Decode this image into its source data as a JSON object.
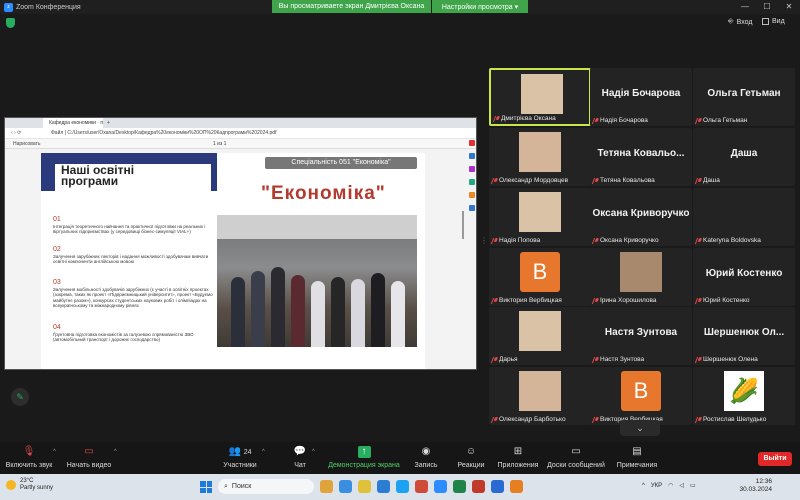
{
  "app": {
    "title": "Zoom Конференция"
  },
  "banner": {
    "sharing_text": "Вы просматриваете экран Дмитрієва Оксана",
    "view_options": "Настройки просмотра ▾"
  },
  "top_controls": {
    "enter": "Вход",
    "view": "Вид"
  },
  "browser": {
    "tab_title": "Кафедра економики · програм",
    "url_prefix": "Файл",
    "url": "C:/Users/user/Oxana/Desktop/Кафедра%20економіки%20ОП%20Кадпрограми%202024.pdf",
    "draw_label": "Нарисовать",
    "page_label": "из 1"
  },
  "slide": {
    "heading": "Наші освітні програми",
    "specialty": "Спеціальність 051 \"Економіка\"",
    "title": "\"Економіка\"",
    "items": [
      {
        "num": "01",
        "text": "Інтеграція теоретичного навчання та практичної підготовки на реальних і віртуальних підприємствах (у середовищі бізнес-симуляції VIAL+)"
      },
      {
        "num": "02",
        "text": "Залучення зарубіжних лекторів і надання можливості здобувачам вивчати освітні компоненти англійською мовою"
      },
      {
        "num": "03",
        "text": "Залучення мобільності здобувачів зарубіжних (є участі в освітніх проектах (зокрема, таких як проект «Підприємницький університет», проект «Будуємо майбутнє разом»), конкурсах студентських наукових робіт і олімпіадах на всеукраїнському та міжнародному рівнях"
      },
      {
        "num": "04",
        "text": "Ґрунтовна підготовка економістів за галузевою спрямованістю ЗВО (автомобільний транспорт і дорожнє господарство)"
      }
    ]
  },
  "participants": [
    {
      "label": "Дмитрієва Оксана",
      "kind": "video",
      "active": true
    },
    {
      "label": "Надія Бочарова",
      "big": "Надія Бочарова",
      "kind": "name"
    },
    {
      "label": "Ольга Гетьман",
      "big": "Ольга Гетьман",
      "kind": "name"
    },
    {
      "label": "Олександр Мордовцев",
      "kind": "video"
    },
    {
      "label": "Тетяна Ковальова",
      "big": "Тетяна Ковальо...",
      "kind": "name"
    },
    {
      "label": "Даша",
      "big": "Даша",
      "kind": "name"
    },
    {
      "label": "Надія Попова",
      "kind": "video"
    },
    {
      "label": "Оксана Криворучко",
      "big": "Оксана Криворучко",
      "kind": "name"
    },
    {
      "label": "Kateryna Boldovska",
      "kind": "blank"
    },
    {
      "label": "Виктория Вербицкая",
      "kind": "avatar",
      "letter": "В"
    },
    {
      "label": "Ірина Хорошилова",
      "kind": "video"
    },
    {
      "label": "Юрий Костенко",
      "big": "Юрий Костенко",
      "kind": "name"
    },
    {
      "label": "Дарья",
      "kind": "video"
    },
    {
      "label": "Настя Зунтова",
      "big": "Настя Зунтова",
      "kind": "name"
    },
    {
      "label": "Шершенюк Олена",
      "big": "Шершенюк Ол...",
      "kind": "name"
    },
    {
      "label": "Олександр Барботько",
      "kind": "video"
    },
    {
      "label": "Виктория Вербицкая",
      "kind": "avatar",
      "letter": "В"
    },
    {
      "label": "Ростислав Шелудько",
      "kind": "corn"
    }
  ],
  "toolbar": {
    "mute": "Включить звук",
    "video": "Начать видео",
    "participants": "Участники",
    "participants_count": "24",
    "chat": "Чат",
    "share": "Демонстрация экрана",
    "record": "Запись",
    "reactions": "Реакции",
    "apps": "Приложения",
    "whiteboards": "Доски сообщений",
    "notes": "Примечания",
    "leave": "Выйти"
  },
  "taskbar": {
    "temp": "23°C",
    "weather": "Partly sunny",
    "search": "Поиск",
    "lang": "УКР",
    "time": "12:36",
    "date": "30.03.2024"
  },
  "colors": {
    "accent_green": "#3fa44a",
    "leave_red": "#e02828",
    "active_border": "#c8e64a",
    "slide_title_red": "#b23a2e"
  }
}
